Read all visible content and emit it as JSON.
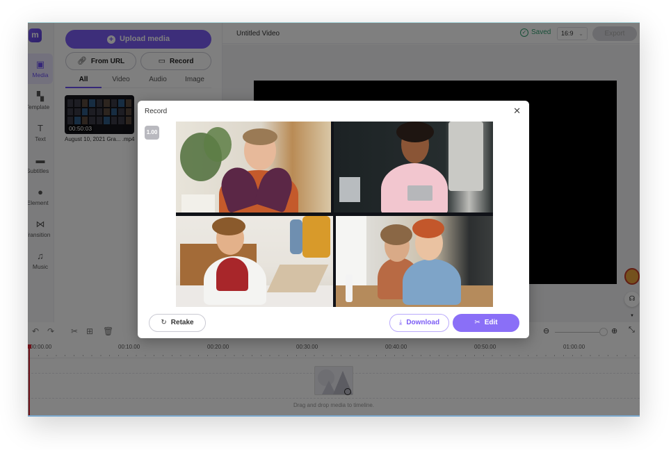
{
  "app": {
    "logo": "m",
    "title": "Untitled Video",
    "saved_label": "Saved",
    "aspect_ratio": "16:9",
    "export_label": "Export",
    "colors": {
      "accent": "#7b5cf5",
      "saved": "#2f9e6e",
      "playhead": "#dd2233"
    }
  },
  "rail": {
    "items": [
      {
        "label": "Media",
        "icon": "folder-plus-icon",
        "active": true
      },
      {
        "label": "Template",
        "icon": "template-icon"
      },
      {
        "label": "Text",
        "icon": "text-icon"
      },
      {
        "label": "Subtitles",
        "icon": "subtitles-icon"
      },
      {
        "label": "Element",
        "icon": "element-icon"
      },
      {
        "label": "Transition",
        "icon": "transition-icon"
      },
      {
        "label": "Music",
        "icon": "music-icon"
      }
    ]
  },
  "media_panel": {
    "upload_label": "Upload media",
    "from_url_label": "From URL",
    "record_label": "Record",
    "tabs": [
      "All",
      "Video",
      "Audio",
      "Image"
    ],
    "active_tab": "All",
    "items": [
      {
        "duration": "00:50:03",
        "name": "August 10, 2021 Gra... .mp4"
      }
    ]
  },
  "timeline": {
    "ticks": [
      "00:00.00",
      "00:10.00",
      "00:20.00",
      "00:30.00",
      "00:40.00",
      "00:50.00",
      "01:00.00"
    ],
    "drop_hint": "Drag and drop media to timeline.",
    "zoom_level": 0.9
  },
  "modal": {
    "title": "Record",
    "speed": "1.00",
    "retake_label": "Retake",
    "download_label": "Download",
    "edit_label": "Edit"
  }
}
